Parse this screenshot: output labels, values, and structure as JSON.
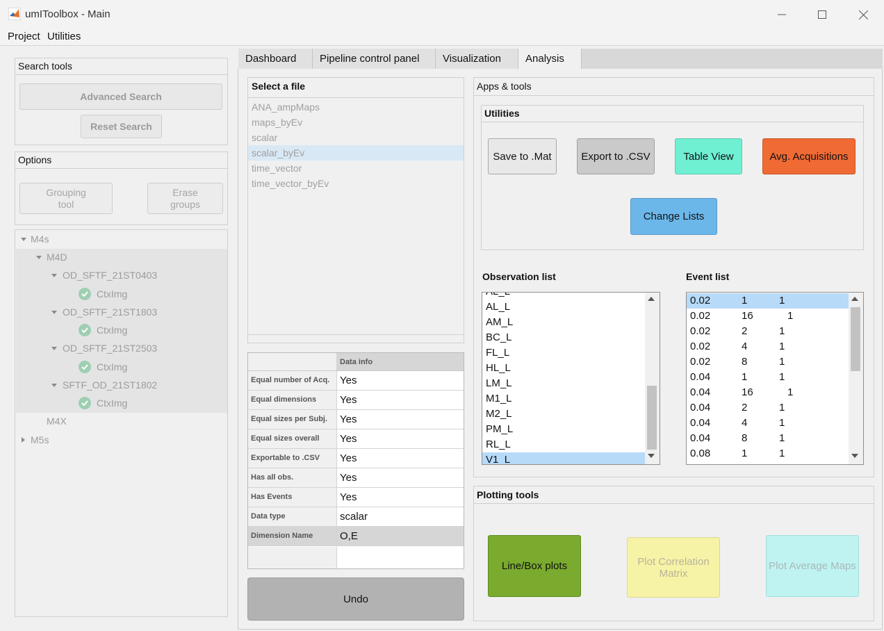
{
  "window": {
    "title": "umIToolbox - Main"
  },
  "menu": [
    "Project",
    "Utilities"
  ],
  "search_tools": {
    "title": "Search tools",
    "advanced": "Advanced Search",
    "reset": "Reset Search"
  },
  "options": {
    "title": "Options",
    "grouping_l1": "Grouping",
    "grouping_l2": "tool",
    "erase_l1": "Erase",
    "erase_l2": "groups"
  },
  "tree": {
    "m4s": "M4s",
    "m4d": "M4D",
    "s1": "OD_SFTF_21ST0403",
    "s2": "OD_SFTF_21ST1803",
    "s3": "OD_SFTF_21ST2503",
    "s4": "SFTF_OD_21ST1802",
    "leaf": "CtxImg",
    "m4x": "M4X",
    "m5s": "M5s"
  },
  "tabs": [
    "Dashboard",
    "Pipeline control panel",
    "Visualization",
    "Analysis"
  ],
  "file_panel": {
    "title": "Select a file",
    "files": [
      "ANA_ampMaps",
      "maps_byEv",
      "scalar",
      "scalar_byEv",
      "time_vector",
      "time_vector_byEv"
    ],
    "selected": "scalar_byEv"
  },
  "data_info": {
    "header": "Data info",
    "rows": [
      {
        "label": "Equal number of Acq.",
        "value": "Yes"
      },
      {
        "label": "Equal dimensions",
        "value": "Yes"
      },
      {
        "label": "Equal sizes per Subj.",
        "value": "Yes"
      },
      {
        "label": "Equal sizes overall",
        "value": "Yes"
      },
      {
        "label": "Exportable to .CSV",
        "value": "Yes"
      },
      {
        "label": "Has all obs.",
        "value": "Yes"
      },
      {
        "label": "Has Events",
        "value": "Yes"
      },
      {
        "label": "Data type",
        "value": "scalar"
      },
      {
        "label": "Dimension Name",
        "value": "O,E"
      }
    ]
  },
  "undo": "Undo",
  "apps": {
    "title": "Apps & tools",
    "utilities_title": "Utilities",
    "save_mat": "Save to .Mat",
    "export_csv": "Export to .CSV",
    "table_view": "Table View",
    "avg_acq": "Avg. Acquisitions",
    "change_lists": "Change Lists",
    "colors": {
      "table_view": "#6ff0d2",
      "avg_acq": "#f06a34",
      "change_lists": "#6cb7ea"
    }
  },
  "observation_list": {
    "title": "Observation list",
    "partial_top": "AL_L",
    "items": [
      "AL_L",
      "AM_L",
      "BC_L",
      "FL_L",
      "HL_L",
      "LM_L",
      "M1_L",
      "M2_L",
      "PM_L",
      "RL_L",
      "V1_L"
    ],
    "selected": "V1_L"
  },
  "event_list": {
    "title": "Event list",
    "items": [
      [
        "0.02",
        "1",
        "1"
      ],
      [
        "0.02",
        "16",
        "1"
      ],
      [
        "0.02",
        "2",
        "1"
      ],
      [
        "0.02",
        "4",
        "1"
      ],
      [
        "0.02",
        "8",
        "1"
      ],
      [
        "0.04",
        "1",
        "1"
      ],
      [
        "0.04",
        "16",
        "1"
      ],
      [
        "0.04",
        "2",
        "1"
      ],
      [
        "0.04",
        "4",
        "1"
      ],
      [
        "0.04",
        "8",
        "1"
      ],
      [
        "0.08",
        "1",
        "1"
      ]
    ]
  },
  "plotting": {
    "title": "Plotting tools",
    "line_box": "Line/Box plots",
    "corr_l1": "Plot Correlation",
    "corr_l2": "Matrix",
    "avg_maps": "Plot Average Maps",
    "colors": {
      "line_box": "#7aab2e",
      "corr": "#f7f3a6",
      "avg_maps": "#bff3f2"
    }
  }
}
